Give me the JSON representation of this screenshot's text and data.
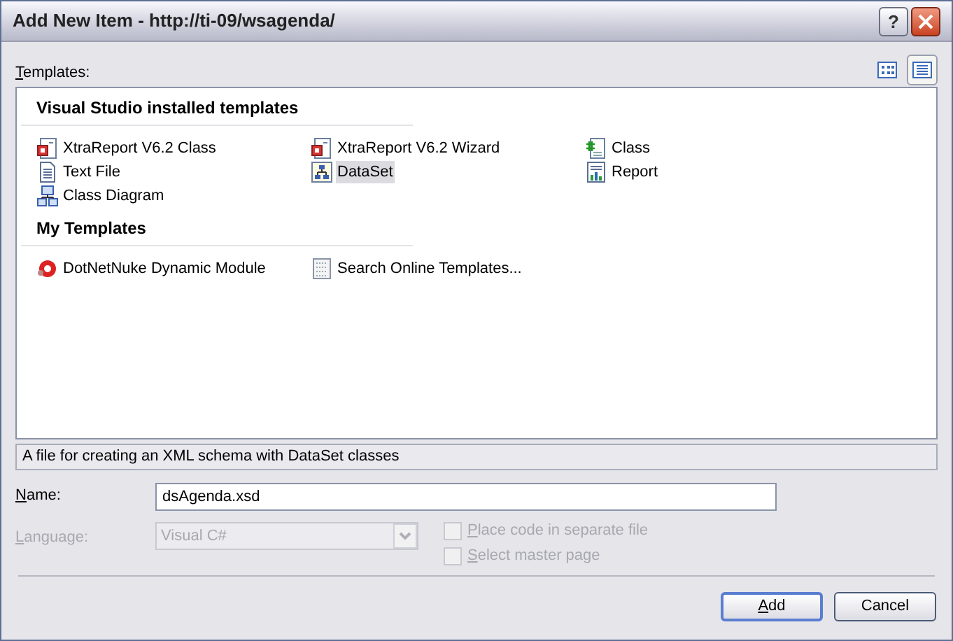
{
  "window": {
    "title": "Add New Item - http://ti-09/wsagenda/",
    "help_button": "?"
  },
  "templates_label": "Templates:",
  "view_buttons": [
    {
      "kind": "large",
      "selected": false
    },
    {
      "kind": "small",
      "selected": true
    }
  ],
  "groups": [
    {
      "title": "Visual Studio installed templates",
      "items": [
        {
          "label": "XtraReport V6.2 Class",
          "kind": "xtra",
          "selected": false
        },
        {
          "label": "XtraReport V6.2 Wizard",
          "kind": "xtra",
          "selected": false
        },
        {
          "label": "Class",
          "kind": "csharp",
          "selected": false
        },
        {
          "label": "Text File",
          "kind": "text",
          "selected": false
        },
        {
          "label": "DataSet",
          "kind": "dataset",
          "selected": true
        },
        {
          "label": "Report",
          "kind": "report",
          "selected": false
        },
        {
          "label": "Class Diagram",
          "kind": "diagram",
          "selected": false
        }
      ]
    },
    {
      "title": "My Templates",
      "items": [
        {
          "label": "DotNetNuke Dynamic Module",
          "kind": "module",
          "selected": false
        },
        {
          "label": "Search Online Templates...",
          "kind": "search",
          "selected": false
        }
      ]
    }
  ],
  "description": "A file for creating an XML schema with DataSet classes",
  "name": {
    "label": "Name:",
    "value": "dsAgenda.xsd"
  },
  "language": {
    "label": "Language:",
    "value": "Visual C#",
    "disabled": true
  },
  "options": [
    {
      "label": "Place code in separate file",
      "checked": false,
      "disabled": true
    },
    {
      "label": "Select master page",
      "checked": false,
      "disabled": true
    }
  ],
  "buttons": [
    {
      "label": "Add",
      "default": true
    },
    {
      "label": "Cancel",
      "default": false
    }
  ]
}
